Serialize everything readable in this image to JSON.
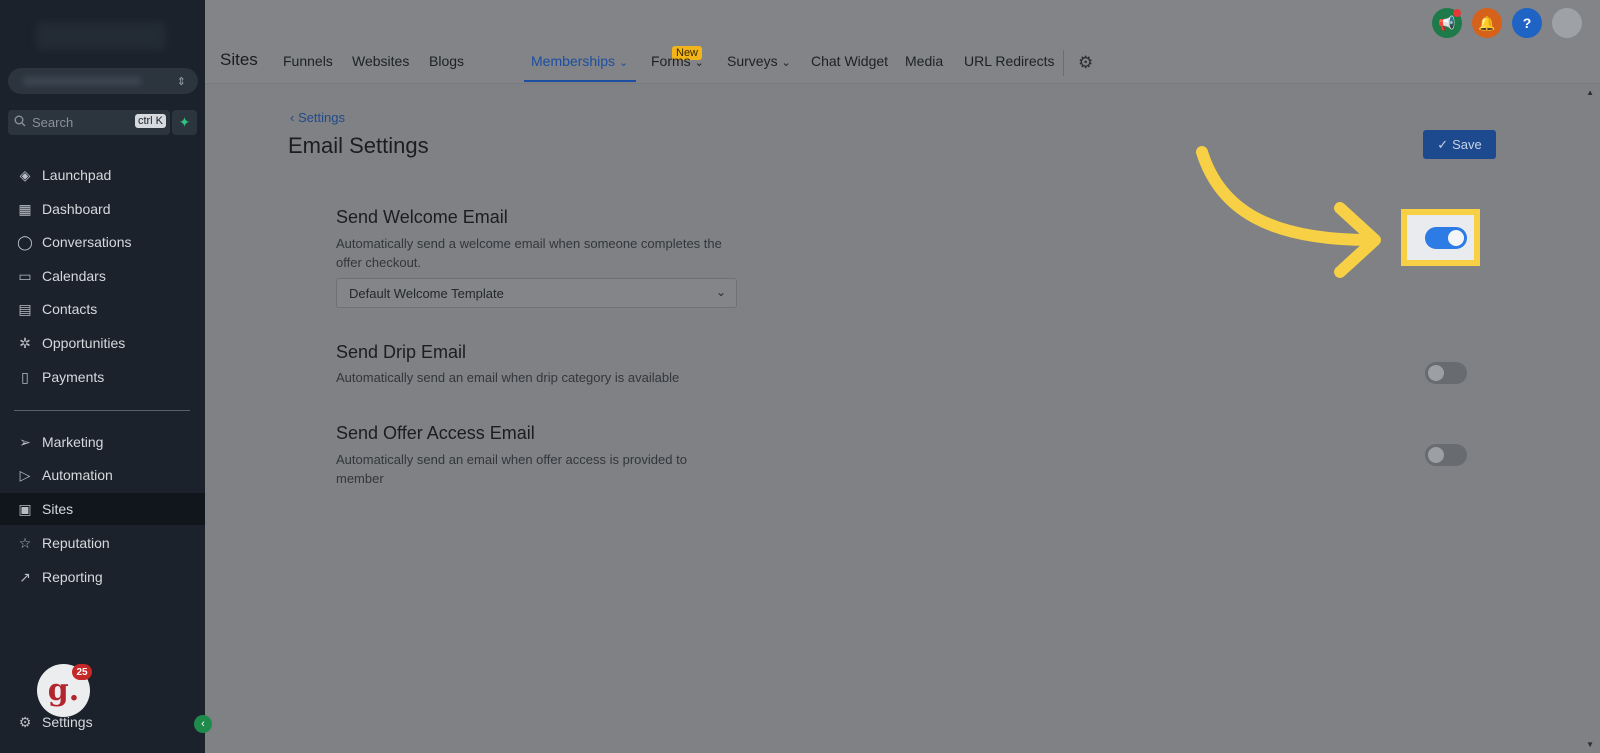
{
  "sidebar": {
    "search": {
      "placeholder": "Search",
      "shortcut": "ctrl K"
    },
    "items": [
      {
        "label": "Launchpad",
        "icon": "rocket-icon"
      },
      {
        "label": "Dashboard",
        "icon": "grid-icon"
      },
      {
        "label": "Conversations",
        "icon": "chat-icon"
      },
      {
        "label": "Calendars",
        "icon": "calendar-icon"
      },
      {
        "label": "Contacts",
        "icon": "contacts-icon"
      },
      {
        "label": "Opportunities",
        "icon": "opportunities-icon"
      },
      {
        "label": "Payments",
        "icon": "payments-icon"
      },
      {
        "label": "Marketing",
        "icon": "send-icon"
      },
      {
        "label": "Automation",
        "icon": "automation-icon"
      },
      {
        "label": "Sites",
        "icon": "sites-icon"
      },
      {
        "label": "Reputation",
        "icon": "star-icon"
      },
      {
        "label": "Reporting",
        "icon": "trend-icon"
      }
    ],
    "settings_label": "Settings",
    "notification_count": "25",
    "avatar_letter": "g."
  },
  "header": {
    "app_title": "Sites",
    "tabs": [
      {
        "label": "Funnels"
      },
      {
        "label": "Websites"
      },
      {
        "label": "Blogs"
      },
      {
        "label": "Memberships"
      },
      {
        "label": "Forms"
      },
      {
        "label": "Surveys"
      },
      {
        "label": "Chat Widget"
      },
      {
        "label": "Media"
      },
      {
        "label": "URL Redirects"
      }
    ],
    "new_badge": "New",
    "icons": {
      "announce_color": "#1f7a4a",
      "bell_color": "#d6611a",
      "help_color": "#1f63c4"
    }
  },
  "main": {
    "back_label": "Settings",
    "title": "Email Settings",
    "save_label": "Save",
    "sections": [
      {
        "title": "Send Welcome Email",
        "desc": "Automatically send a welcome email when someone completes the offer checkout.",
        "enabled": true,
        "template": "Default Welcome Template"
      },
      {
        "title": "Send Drip Email",
        "desc": "Automatically send an email when drip category is available",
        "enabled": false
      },
      {
        "title": "Send Offer Access Email",
        "desc": "Automatically send an email when offer access is provided to member",
        "enabled": false
      }
    ]
  },
  "colors": {
    "accent": "#2d7be5",
    "highlight": "#f7d045"
  }
}
